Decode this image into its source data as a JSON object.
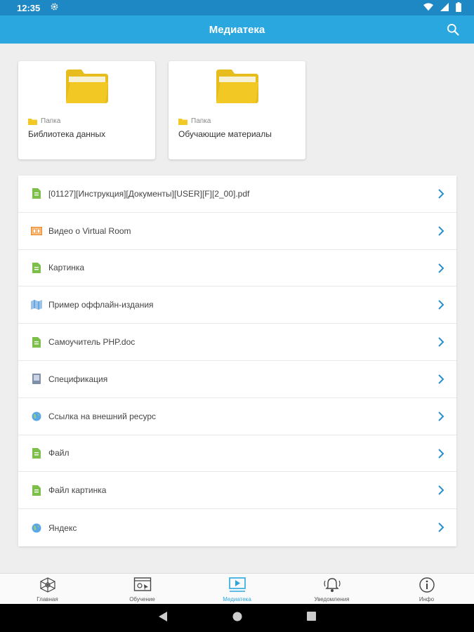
{
  "status_bar": {
    "time": "12:35"
  },
  "app_bar": {
    "title": "Медиатека"
  },
  "folders": [
    {
      "kind": "Папка",
      "name": "Библиотека данных"
    },
    {
      "kind": "Папка",
      "name": "Обучающие материалы"
    }
  ],
  "items": [
    {
      "label": "[01127][Инструкция][Документы][USER][F][2_00].pdf",
      "icon": "file-green-icon"
    },
    {
      "label": "Видео о Virtual Room",
      "icon": "video-icon"
    },
    {
      "label": "Картинка",
      "icon": "file-green-icon"
    },
    {
      "label": "Пример оффлайн-издания",
      "icon": "map-book-icon"
    },
    {
      "label": "Самоучитель PHP.doc",
      "icon": "file-green-icon"
    },
    {
      "label": "Спецификация",
      "icon": "book-icon"
    },
    {
      "label": "Ссылка на внешний ресурс",
      "icon": "globe-icon"
    },
    {
      "label": "Файл",
      "icon": "file-green-icon"
    },
    {
      "label": "Файл картинка",
      "icon": "file-green-icon"
    },
    {
      "label": "Яндекс",
      "icon": "globe-icon"
    }
  ],
  "bottom_nav": [
    {
      "label": "Главная",
      "icon": "home-cube-icon"
    },
    {
      "label": "Обучение",
      "icon": "learning-icon"
    },
    {
      "label": "Медиатека",
      "icon": "media-icon",
      "active": true
    },
    {
      "label": "Уведомления",
      "icon": "bell-icon"
    },
    {
      "label": "Инфо",
      "icon": "info-icon"
    }
  ],
  "colors": {
    "accent": "#2aa7df",
    "status_bar": "#1e88c4",
    "folder": "#f2c924",
    "file_green": "#7cc04a",
    "video_orange": "#f08a24",
    "background": "#eeeeee"
  }
}
